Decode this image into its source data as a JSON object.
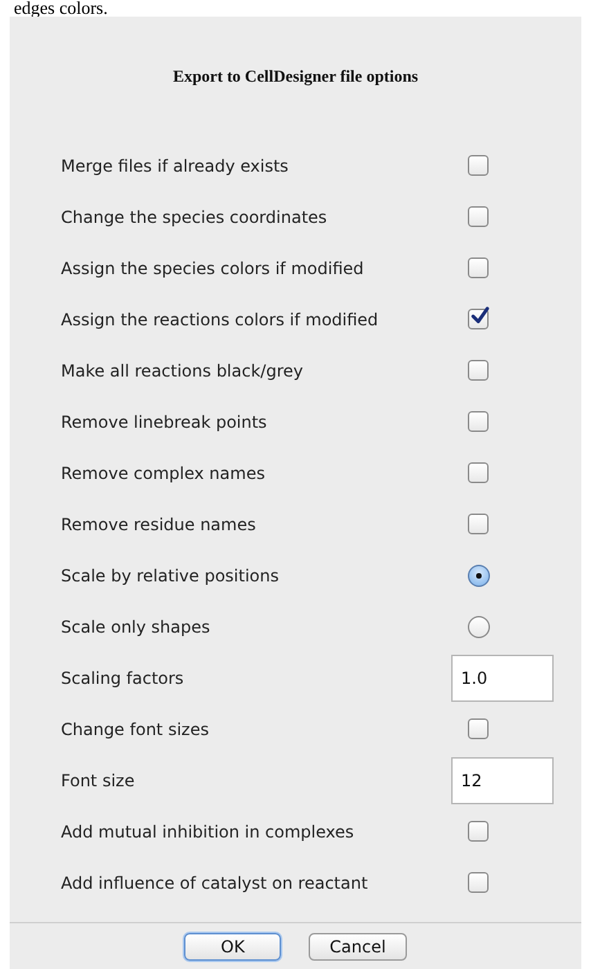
{
  "background_text": "edges colors.",
  "dialog": {
    "title": "Export to CellDesigner file options",
    "options": [
      {
        "kind": "checkbox",
        "label": "Merge files if already exists",
        "checked": false
      },
      {
        "kind": "checkbox",
        "label": "Change the species coordinates",
        "checked": false
      },
      {
        "kind": "checkbox",
        "label": "Assign the species colors if modified",
        "checked": false
      },
      {
        "kind": "checkbox",
        "label": "Assign the reactions colors if modified",
        "checked": true
      },
      {
        "kind": "checkbox",
        "label": "Make all reactions black/grey",
        "checked": false
      },
      {
        "kind": "checkbox",
        "label": "Remove linebreak points",
        "checked": false
      },
      {
        "kind": "checkbox",
        "label": "Remove complex names",
        "checked": false
      },
      {
        "kind": "checkbox",
        "label": "Remove residue names",
        "checked": false
      },
      {
        "kind": "radio",
        "label": "Scale by relative positions",
        "selected": true
      },
      {
        "kind": "radio",
        "label": "Scale only shapes",
        "selected": false
      },
      {
        "kind": "field",
        "label": "Scaling factors",
        "value": "1.0"
      },
      {
        "kind": "checkbox",
        "label": "Change font sizes",
        "checked": false
      },
      {
        "kind": "field",
        "label": "Font size",
        "value": "12"
      },
      {
        "kind": "checkbox",
        "label": "Add mutual inhibition in complexes",
        "checked": false
      },
      {
        "kind": "checkbox",
        "label": "Add influence of catalyst on reactant",
        "checked": false
      }
    ],
    "buttons": [
      {
        "label": "OK",
        "default": true
      },
      {
        "label": "Cancel",
        "default": false
      }
    ]
  }
}
